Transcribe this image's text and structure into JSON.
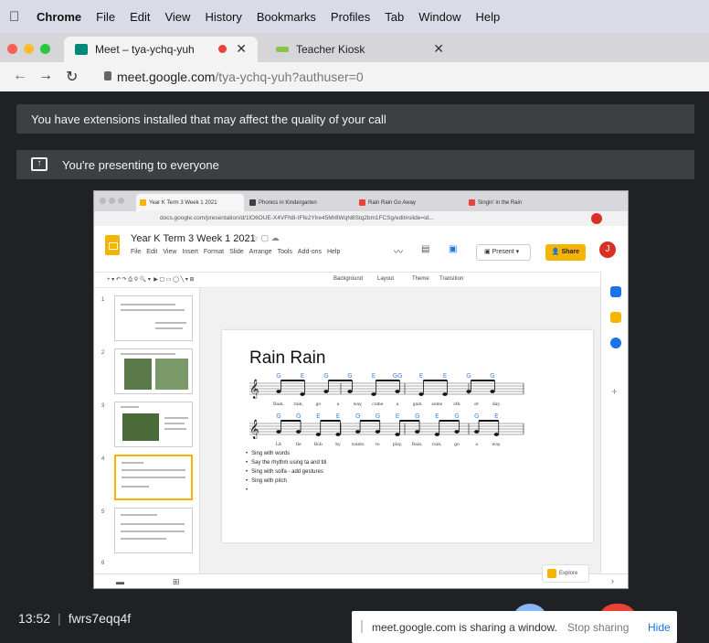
{
  "menubar": {
    "items": [
      "Chrome",
      "File",
      "Edit",
      "View",
      "History",
      "Bookmarks",
      "Profiles",
      "Tab",
      "Window",
      "Help"
    ]
  },
  "tabs": {
    "active": {
      "title": "Meet – tya-ychq-yuh",
      "favicon": "meet-icon"
    },
    "inactive": {
      "title": "Teacher Kiosk",
      "favicon": "kiosk-icon"
    }
  },
  "address": {
    "host": "meet.google.com",
    "path": "/tya-ychq-yuh?authuser=0"
  },
  "meet": {
    "extensions_banner": "You have extensions installed that may affect the quality of your call",
    "presenting_banner": "You're presenting to everyone",
    "time": "13:52",
    "meeting_code": "fwrs7eqq4f",
    "sharing_message": "meet.google.com is sharing a window.",
    "stop_sharing": "Stop sharing",
    "hide": "Hide"
  },
  "shared_window": {
    "browser_tabs": [
      "Year K Term 3 Week 1 2021",
      "Phonics in Kindergarten",
      "Rain Rain Go Away",
      "Singin' in the Rain"
    ],
    "url": "docs.google.com/presentation/d/1lO6OUE-X4VFN8-tFfe2Ylre45Mr8WqN8Stq2bm1FCSg/edit#slide=id...",
    "doc_title": "Year K Term 3 Week 1 2021",
    "doc_menu": [
      "File",
      "Edit",
      "View",
      "Insert",
      "Format",
      "Slide",
      "Arrange",
      "Tools",
      "Add-ons",
      "Help"
    ],
    "present_label": "Present",
    "share_label": "Share",
    "user_initial": "J",
    "toolbar": [
      "Background",
      "Layout",
      "Theme",
      "Transition"
    ],
    "slide_numbers": [
      "1",
      "2",
      "3",
      "4",
      "5",
      "6"
    ],
    "slide": {
      "title": "Rain Rain",
      "row1_notes": [
        "G",
        "E",
        "G",
        "G",
        "E",
        "GG",
        "E",
        "E",
        "G",
        "G"
      ],
      "row1_lyrics": [
        "Rain,",
        "rain,",
        "go",
        "a",
        "way,",
        "come",
        "a",
        "gain",
        "some",
        "oth",
        "er",
        "day."
      ],
      "row2_notes": [
        "G",
        "G",
        "E",
        "E",
        "G",
        "G",
        "E",
        "G",
        "E",
        "G",
        "G",
        "E"
      ],
      "row2_lyrics": [
        "Lit",
        "tle",
        "Bob",
        "by",
        "wants",
        "to",
        "play,",
        "Rain,",
        "rain,",
        "go",
        "a",
        "way."
      ],
      "bullets": [
        "Sing with words",
        "Say the rhythm using ta and titi",
        "Sing with solfa - add gestures",
        "Sing with pitch",
        ""
      ]
    },
    "explore_label": "Explore"
  },
  "colors": {
    "meet_bg": "#202124",
    "banner_bg": "#3c4043",
    "slides_yellow": "#f4b400",
    "note_blue": "#4285f4",
    "link_blue": "#1a73e8"
  }
}
